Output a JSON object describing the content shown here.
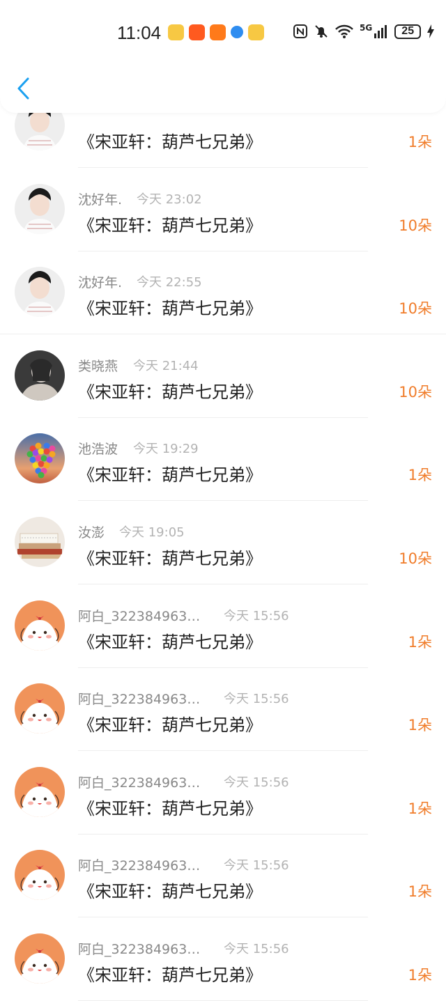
{
  "status_bar": {
    "time": "11:04",
    "battery": "25",
    "network": "5G",
    "icons": [
      "weibo-icon",
      "kuaishou-icon",
      "firefox-icon",
      "compass-icon",
      "weibo-icon",
      "nfc-icon",
      "mute-icon",
      "wifi-icon",
      "signal-icon",
      "charging-icon"
    ]
  },
  "nav": {
    "back_icon": "chevron-left-icon",
    "accent": "#1aa0f0"
  },
  "gifts": [
    {
      "name": "",
      "time": "",
      "message": "《宋亚轩：葫芦七兄弟》",
      "count": "1朵",
      "avatar": "boy-photo"
    },
    {
      "name": "沈好年.",
      "time": "今天 23:02",
      "message": "《宋亚轩：葫芦七兄弟》",
      "count": "10朵",
      "avatar": "boy-photo"
    },
    {
      "name": "沈好年.",
      "time": "今天 22:55",
      "message": "《宋亚轩：葫芦七兄弟》",
      "count": "10朵",
      "avatar": "boy-photo"
    },
    {
      "name": "类晓燕",
      "time": "今天 21:44",
      "message": "《宋亚轩：葫芦七兄弟》",
      "count": "10朵",
      "avatar": "girl-photo"
    },
    {
      "name": "池浩波",
      "time": "今天 19:29",
      "message": "《宋亚轩：葫芦七兄弟》",
      "count": "1朵",
      "avatar": "heart-balloons"
    },
    {
      "name": "汝澎",
      "time": "今天 19:05",
      "message": "《宋亚轩：葫芦七兄弟》",
      "count": "10朵",
      "avatar": "books-photo"
    },
    {
      "name": "阿白_322384963…",
      "time": "今天 15:56",
      "message": "《宋亚轩：葫芦七兄弟》",
      "count": "1朵",
      "avatar": "cartoon-bunny"
    },
    {
      "name": "阿白_322384963…",
      "time": "今天 15:56",
      "message": "《宋亚轩：葫芦七兄弟》",
      "count": "1朵",
      "avatar": "cartoon-bunny"
    },
    {
      "name": "阿白_322384963…",
      "time": "今天 15:56",
      "message": "《宋亚轩：葫芦七兄弟》",
      "count": "1朵",
      "avatar": "cartoon-bunny"
    },
    {
      "name": "阿白_322384963…",
      "time": "今天 15:56",
      "message": "《宋亚轩：葫芦七兄弟》",
      "count": "1朵",
      "avatar": "cartoon-bunny"
    },
    {
      "name": "阿白_322384963…",
      "time": "今天 15:56",
      "message": "《宋亚轩：葫芦七兄弟》",
      "count": "1朵",
      "avatar": "cartoon-bunny"
    }
  ],
  "colors": {
    "count": "#f07c2a",
    "name": "#888888",
    "time": "#b3b3b3",
    "message": "#222222"
  }
}
